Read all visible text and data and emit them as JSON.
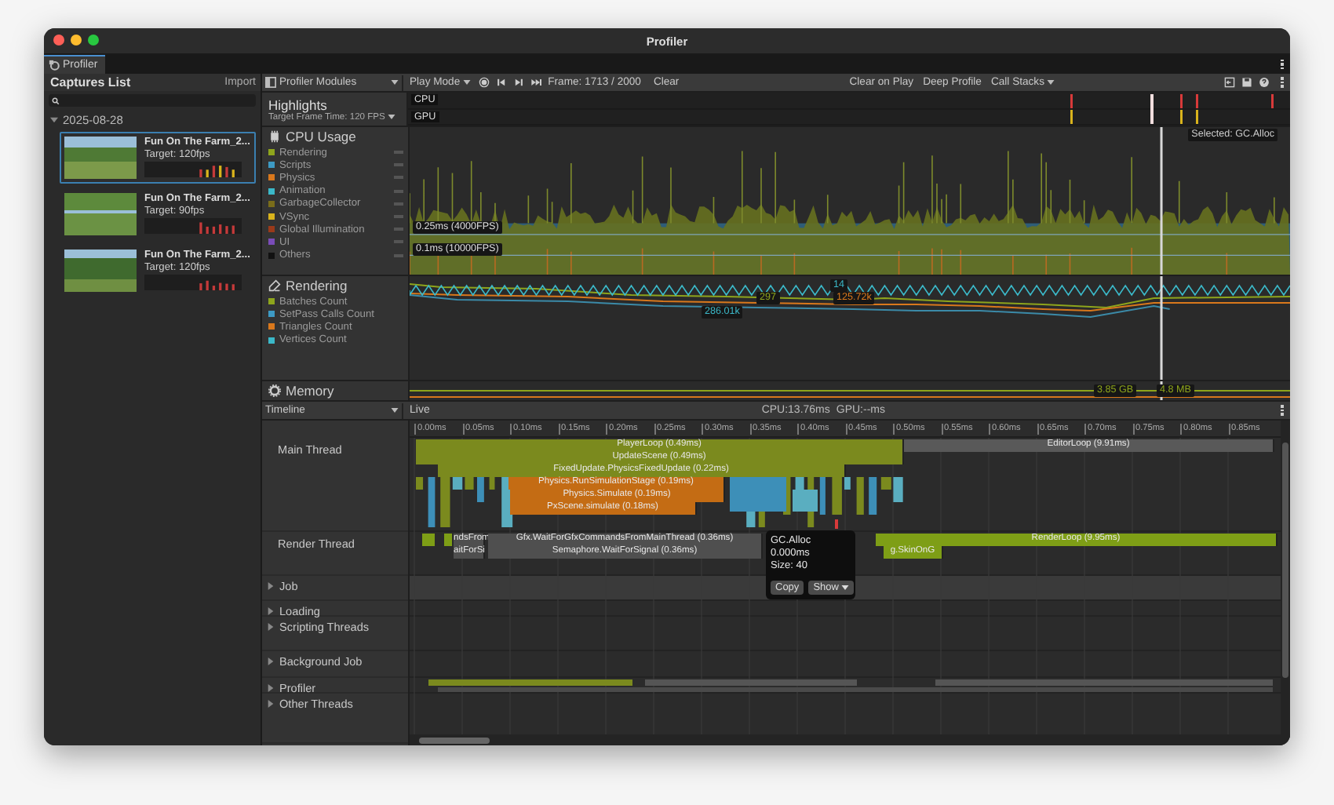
{
  "window": {
    "title": "Profiler"
  },
  "tab": {
    "label": "Profiler"
  },
  "captures": {
    "title": "Captures List",
    "import": "Import",
    "date": {
      "label": "2025-08-28",
      "expanded": true
    },
    "items": [
      {
        "title": "Fun On The Farm_2...",
        "target": "Target: 120fps",
        "selected": true
      },
      {
        "title": "Fun On The Farm_2...",
        "target": "Target: 90fps",
        "selected": false
      },
      {
        "title": "Fun On The Farm_2...",
        "target": "Target: 120fps",
        "selected": false
      }
    ]
  },
  "toolbar": {
    "modules": "Profiler Modules",
    "play_mode": "Play Mode",
    "frame": "Frame: 1713 / 2000",
    "clear": "Clear",
    "clear_on_play": "Clear on Play",
    "deep_profile": "Deep Profile",
    "call_stacks": "Call Stacks"
  },
  "highlights": {
    "title": "Highlights",
    "target": "Target Frame Time: 120 FPS",
    "lanes": [
      "CPU",
      "GPU"
    ]
  },
  "modules": [
    {
      "kind": "cpu",
      "title": "CPU Usage",
      "legend": [
        {
          "name": "Rendering",
          "color": "#8ea51c"
        },
        {
          "name": "Scripts",
          "color": "#3d9ac4"
        },
        {
          "name": "Physics",
          "color": "#d9781c"
        },
        {
          "name": "Animation",
          "color": "#3bb8c8"
        },
        {
          "name": "GarbageCollector",
          "color": "#7a6d1a"
        },
        {
          "name": "VSync",
          "color": "#d9b31c"
        },
        {
          "name": "Global Illumination",
          "color": "#9a3a1a"
        },
        {
          "name": "UI",
          "color": "#7a4cb8"
        },
        {
          "name": "Others",
          "color": "#111111"
        }
      ],
      "labels": [
        "0.25ms (4000FPS)",
        "0.1ms (10000FPS)",
        "Selected: GC.Alloc"
      ]
    },
    {
      "kind": "rendering",
      "title": "Rendering",
      "legend": [
        {
          "name": "Batches Count",
          "color": "#8ea51c"
        },
        {
          "name": "SetPass Calls Count",
          "color": "#3d9ac4"
        },
        {
          "name": "Triangles Count",
          "color": "#d9781c"
        },
        {
          "name": "Vertices Count",
          "color": "#3bb8c8"
        }
      ],
      "labels": [
        "14",
        "297",
        "125.72k",
        "286.01k"
      ]
    },
    {
      "kind": "memory",
      "title": "Memory",
      "labels": [
        "3.85 GB",
        "4.8 MB"
      ]
    }
  ],
  "timeline": {
    "view": "Timeline",
    "live": "Live",
    "cpu": "CPU:13.76ms",
    "gpu": "GPU:--ms",
    "ticks": [
      "0.00ms",
      "0.05ms",
      "0.10ms",
      "0.15ms",
      "0.20ms",
      "0.25ms",
      "0.30ms",
      "0.35ms",
      "0.40ms",
      "0.45ms",
      "0.50ms",
      "0.55ms",
      "0.60ms",
      "0.65ms",
      "0.70ms",
      "0.75ms",
      "0.80ms",
      "0.85ms"
    ],
    "threads": [
      {
        "name": "Main Thread"
      },
      {
        "name": "Render Thread"
      }
    ],
    "groups": [
      {
        "name": "Job",
        "expanded": false
      },
      {
        "name": "Loading",
        "expanded": false
      },
      {
        "name": "Scripting Threads",
        "expanded": false
      },
      {
        "name": "Background Job",
        "expanded": false
      },
      {
        "name": "Profiler",
        "expanded": false
      },
      {
        "name": "Other Threads",
        "expanded": false
      }
    ],
    "blocks": [
      {
        "label": "PlayerLoop (0.49ms)",
        "kind": "frame"
      },
      {
        "label": "UpdateScene (0.49ms)",
        "kind": "frame"
      },
      {
        "label": "FixedUpdate.PhysicsFixedUpdate (0.22ms)",
        "kind": "frame"
      },
      {
        "label": "Physics.RunSimulationStage (0.19ms)",
        "kind": "physics"
      },
      {
        "label": "Physics.Simulate (0.19ms)",
        "kind": "physics"
      },
      {
        "label": "PxScene.simulate (0.18ms)",
        "kind": "physics"
      },
      {
        "label": "EditorLoop (9.91ms)",
        "kind": "editor"
      },
      {
        "label": "ndsFrom",
        "kind": "wait"
      },
      {
        "label": "Gfx.WaitForGfxCommandsFromMainThread (0.36ms)",
        "kind": "wait"
      },
      {
        "label": "aitForSi",
        "kind": "wait"
      },
      {
        "label": "Semaphore.WaitForSignal (0.36ms)",
        "kind": "wait"
      },
      {
        "label": "RenderLoop (9.95ms)",
        "kind": "render"
      },
      {
        "label": "g.SkinOnG",
        "kind": "render"
      }
    ],
    "tooltip": {
      "name": "GC.Alloc",
      "time": "0.000ms",
      "size": "Size: 40",
      "copy": "Copy",
      "show": "Show"
    }
  }
}
